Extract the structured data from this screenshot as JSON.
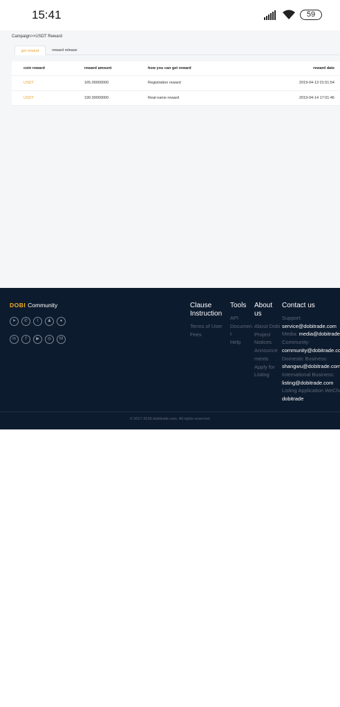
{
  "status_bar": {
    "time": "15:41",
    "battery": "59"
  },
  "breadcrumb": "Campaign>>USDT Reward",
  "tabs": [
    {
      "label": "get reward"
    },
    {
      "label": "reward release"
    }
  ],
  "table": {
    "headers": [
      "coin reward",
      "reward amount",
      "how you can get reward",
      "reward date"
    ],
    "rows": [
      [
        "USDT",
        "165.00000000",
        "Registration reward",
        "2019-04-13 01:51:54"
      ],
      [
        "USDT",
        "190.00000000",
        "Real-name reward",
        "2019-04-14 17:01:46"
      ]
    ]
  },
  "footer": {
    "logo_brand": "DOBI",
    "logo_text": "Community",
    "social_row1": [
      "telegram-icon",
      "whatsapp-icon",
      "twitter-icon",
      "qq-icon",
      "wechat-icon"
    ],
    "social_row2": [
      "linkedin-icon",
      "facebook-icon",
      "youtube-icon",
      "instagram-icon",
      "medium-icon"
    ],
    "clause": {
      "title_line1": "Clause",
      "title_line2": "Instruction",
      "links": [
        "Terms of User",
        "Fees"
      ]
    },
    "tools": {
      "title": "Tools",
      "links": [
        "API",
        "Documen",
        "t",
        "Help"
      ]
    },
    "about": {
      "title_line1": "About",
      "title_line2": "us",
      "links": [
        "About Dobi",
        "Project",
        "Notices",
        "Announce",
        "ments",
        "Apply for",
        "Listing"
      ]
    },
    "contact": {
      "title": "Contact us",
      "support_label": "Support:",
      "support_value": "service@dobitrade.com",
      "media_label": "Media:",
      "media_value": "media@dobitrade",
      "community_label": "Community:",
      "community_value": "community@dobitrade.co",
      "domestic_label": "Domestic Business:",
      "domestic_value": "shangwu@dobitrade.com",
      "international_label": "International Business:",
      "international_value": "listing@dobitrade.com",
      "wechat_label": "Listing Application WeCha",
      "wechat_value": "dobitrade"
    },
    "copyright": "© 2017-2018 dobitrade.com. All rights reserved."
  },
  "colors": {
    "accent": "#f0a020",
    "footer_bg": "#0d1b2e",
    "page_bg": "#f5f6f8"
  }
}
